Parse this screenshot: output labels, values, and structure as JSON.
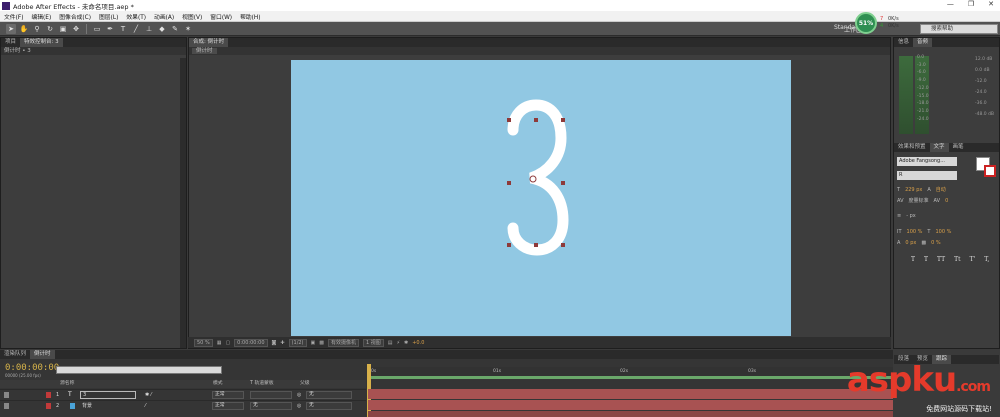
{
  "window": {
    "title": "Adobe After Effects - 未命名项目.aep *",
    "minimize": "—",
    "restore": "❐",
    "close": "✕"
  },
  "menu": [
    "文件(F)",
    "编辑(E)",
    "图像合成(C)",
    "图层(L)",
    "效果(T)",
    "动画(A)",
    "视图(V)",
    "窗口(W)",
    "帮助(H)"
  ],
  "toolbar": {
    "workspace_label": "工作区:",
    "workspace_value": "Standard",
    "search_help_placeholder": "搜索帮助"
  },
  "monitor": {
    "cpu_percent": "51%",
    "up_count": "7",
    "up_speed": "0K/s",
    "down_count": "4",
    "down_speed": "0K/s"
  },
  "left_panel": {
    "tabs": [
      "项目",
      "特效控制台: 3"
    ],
    "sub": "倒计时 • 3"
  },
  "viewer": {
    "tab": "合成: 倒计时",
    "sub_tab": "倒计时",
    "digit": "3",
    "zoom": "50 %",
    "timecode": "0:00:00:00",
    "resolution": "(1/2)",
    "camera": "有效摄像机",
    "views": "1 视图",
    "exposure": "+0.0"
  },
  "right_panel": {
    "audio_tabs": [
      "信息",
      "音频"
    ],
    "db_left": [
      "0.0",
      "-3.0",
      "-6.0",
      "-9.0",
      "-12.0",
      "-15.0",
      "-18.0",
      "-21.0",
      "-24.0"
    ],
    "db_right": [
      "12.0 dB",
      "0.0 dB",
      "-12.0",
      "-24.0",
      "-36.0",
      "-48.0 dB"
    ],
    "char_tabs": [
      "效果和预置",
      "文字",
      "画笔"
    ],
    "font_name": "Adobe Fangsong...",
    "font_style": "R",
    "size": "229 px",
    "leading": "自动",
    "kerning_label": "度量标准",
    "tracking": "0",
    "stroke": "- px",
    "vscale": "100 %",
    "hscale": "100 %",
    "baseline": "0 px",
    "tsume": "0 %",
    "formats": [
      "T",
      "T",
      "TT",
      "Tt",
      "T'",
      "T,"
    ],
    "bottom_tabs": [
      "段落",
      "预览",
      "跟踪"
    ]
  },
  "timeline": {
    "tabs": [
      "渲染队列",
      "倒计时"
    ],
    "timecode": "0:00:00:00",
    "fps": "00000 (25.00 fps)",
    "headers": {
      "source": "源名称",
      "mode": "模式",
      "trkmat": "T 轨道蒙板",
      "parent": "父级"
    },
    "ruler": [
      "0s",
      "01s",
      "02s",
      "03s"
    ],
    "layers": [
      {
        "num": "1",
        "name": "3",
        "mode": "正常",
        "trkmat": "",
        "parent": "无",
        "color": "#c23a3a",
        "icon": "text-layer-icon"
      },
      {
        "num": "2",
        "name": "背景",
        "mode": "正常",
        "trkmat": "无",
        "parent": "无",
        "color": "#4aa3d8",
        "icon": "solid-layer-icon"
      }
    ]
  },
  "watermark": {
    "brand": "aspku",
    "brand_tld": ".com",
    "tagline": "免费网站源码下载站!"
  }
}
